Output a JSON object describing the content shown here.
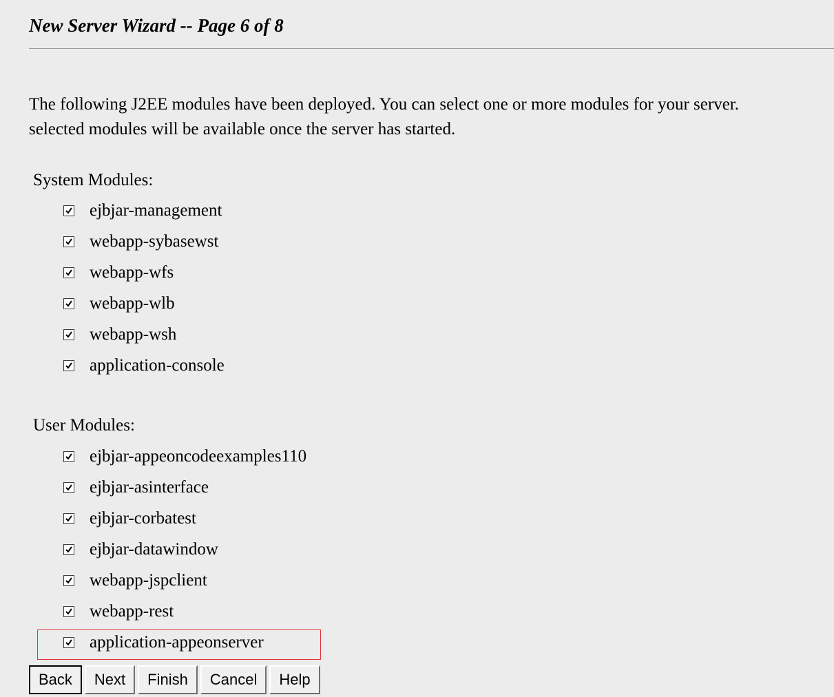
{
  "wizard": {
    "title": "New Server Wizard -- Page 6 of 8",
    "intro_line1": "The following J2EE modules have been deployed. You can select one or more modules for your server.",
    "intro_line2": "selected modules will be available once the server has started."
  },
  "system_modules": {
    "label": "System Modules:",
    "items": [
      {
        "label": "ejbjar-management",
        "checked": true
      },
      {
        "label": "webapp-sybasewst",
        "checked": true
      },
      {
        "label": "webapp-wfs",
        "checked": true
      },
      {
        "label": "webapp-wlb",
        "checked": true
      },
      {
        "label": "webapp-wsh",
        "checked": true
      },
      {
        "label": "application-console",
        "checked": true
      }
    ]
  },
  "user_modules": {
    "label": "User Modules:",
    "items": [
      {
        "label": "ejbjar-appeoncodeexamples110",
        "checked": true
      },
      {
        "label": "ejbjar-asinterface",
        "checked": true
      },
      {
        "label": "ejbjar-corbatest",
        "checked": true
      },
      {
        "label": "ejbjar-datawindow",
        "checked": true
      },
      {
        "label": "webapp-jspclient",
        "checked": true
      },
      {
        "label": "webapp-rest",
        "checked": true
      },
      {
        "label": "application-appeonserver",
        "checked": true
      }
    ]
  },
  "buttons": {
    "back": "Back",
    "next": "Next",
    "finish": "Finish",
    "cancel": "Cancel",
    "help": "Help"
  },
  "colors": {
    "background": "#ececec",
    "highlight_border": "#e0343e"
  },
  "icons": {
    "checkbox": "checkmark-icon"
  }
}
